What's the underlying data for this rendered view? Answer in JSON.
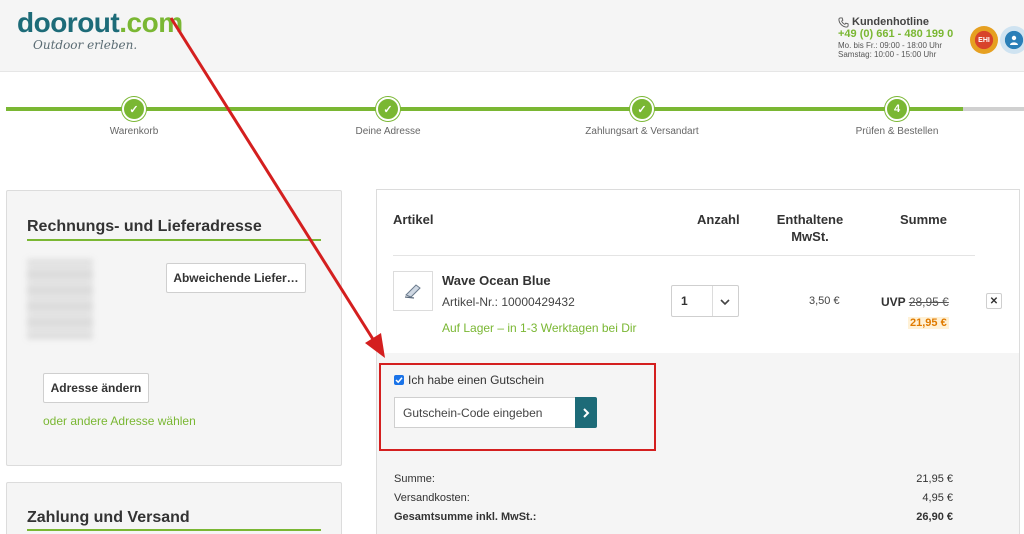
{
  "header": {
    "logo_main_a": "doorout",
    "logo_main_b": ".com",
    "logo_tagline": "Outdoor erleben.",
    "hotline_title": "Kundenhotline",
    "hotline_number": "+49 (0) 661 - 480 199 0",
    "hotline_hours_1": "Mo. bis Fr.: 09:00 - 18:00 Uhr",
    "hotline_hours_2": "Samstag: 10:00 - 15:00 Uhr",
    "seal1_text": "EHI",
    "seal2_text": "",
    "icons": [
      "phone-icon",
      "ehi-seal-icon",
      "trust-seal-icon"
    ]
  },
  "steps": [
    {
      "label": "Warenkorb",
      "state": "done",
      "symbol": "✓"
    },
    {
      "label": "Deine Adresse",
      "state": "done",
      "symbol": "✓"
    },
    {
      "label": "Zahlungsart & Versandart",
      "state": "done",
      "symbol": "✓"
    },
    {
      "label": "Prüfen & Bestellen",
      "state": "current",
      "symbol": "4"
    }
  ],
  "address_panel": {
    "title": "Rechnungs- und Lieferadresse",
    "alt_delivery_button": "Abweichende Liefer…",
    "change_address_button": "Adresse ändern",
    "choose_other_link": "oder andere Adresse wählen"
  },
  "payment_panel": {
    "title": "Zahlung und Versand"
  },
  "cart": {
    "headers": {
      "article": "Artikel",
      "quantity": "Anzahl",
      "vat_line1": "Enthaltene",
      "vat_line2": "MwSt.",
      "sum": "Summe"
    },
    "item": {
      "name": "Wave Ocean Blue",
      "sku": "Artikel-Nr.: 10000429432",
      "stock": "Auf Lager – in 1-3 Werktagen bei Dir",
      "quantity": "1",
      "vat": "3,50 €",
      "uvp_label": "UVP",
      "uvp_price": "28,95 €",
      "price": "21,95 €",
      "remove": "✕"
    },
    "coupon": {
      "checkbox_label": "Ich habe einen Gutschein",
      "checked": true,
      "input_placeholder": "Gutschein-Code eingeben"
    },
    "totals": [
      {
        "label": "Summe:",
        "value": "21,95 €",
        "bold": false
      },
      {
        "label": "Versandkosten:",
        "value": "4,95 €",
        "bold": false
      },
      {
        "label": "Gesamtsumme inkl. MwSt.:",
        "value": "26,90 €",
        "bold": true
      }
    ]
  },
  "colors": {
    "brand_green": "#7ab733",
    "brand_teal": "#1d6b78",
    "highlight_red": "#d41f1f",
    "price_orange": "#e07b00"
  }
}
